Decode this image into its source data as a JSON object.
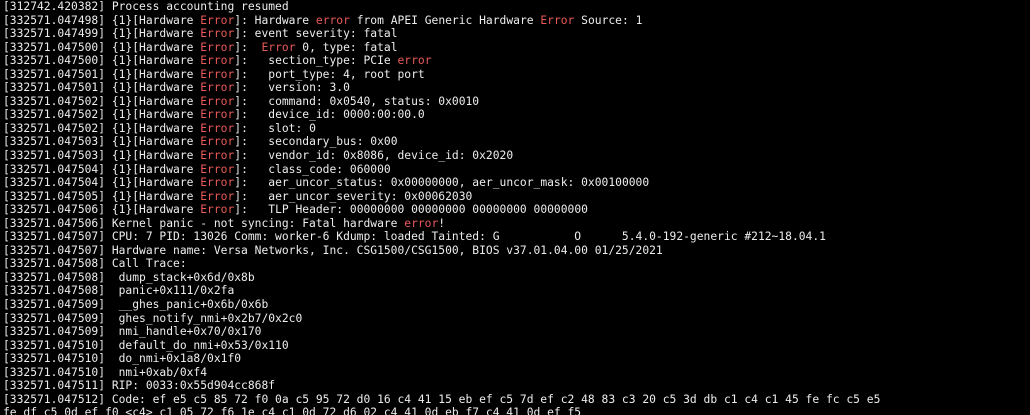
{
  "colors": {
    "background": "#000000",
    "text": "#ededed",
    "error": "#e85a5a"
  },
  "terminal": {
    "lines": [
      [
        {
          "t": "[312742.420382] Process accounting resumed"
        }
      ],
      [
        {
          "t": "[332571.047498] {1}[Hardware "
        },
        {
          "t": "Error",
          "c": "red"
        },
        {
          "t": "]: Hardware "
        },
        {
          "t": "error",
          "c": "red"
        },
        {
          "t": " from APEI Generic Hardware "
        },
        {
          "t": "Error",
          "c": "red"
        },
        {
          "t": " Source: 1"
        }
      ],
      [
        {
          "t": "[332571.047499] {1}[Hardware "
        },
        {
          "t": "Error",
          "c": "red"
        },
        {
          "t": "]: event severity: fatal"
        }
      ],
      [
        {
          "t": "[332571.047500] {1}[Hardware "
        },
        {
          "t": "Error",
          "c": "red"
        },
        {
          "t": "]:  "
        },
        {
          "t": "Error",
          "c": "red"
        },
        {
          "t": " 0, type: fatal"
        }
      ],
      [
        {
          "t": "[332571.047500] {1}[Hardware "
        },
        {
          "t": "Error",
          "c": "red"
        },
        {
          "t": "]:   section_type: PCIe "
        },
        {
          "t": "error",
          "c": "red"
        }
      ],
      [
        {
          "t": "[332571.047501] {1}[Hardware "
        },
        {
          "t": "Error",
          "c": "red"
        },
        {
          "t": "]:   port_type: 4, root port"
        }
      ],
      [
        {
          "t": "[332571.047501] {1}[Hardware "
        },
        {
          "t": "Error",
          "c": "red"
        },
        {
          "t": "]:   version: 3.0"
        }
      ],
      [
        {
          "t": "[332571.047502] {1}[Hardware "
        },
        {
          "t": "Error",
          "c": "red"
        },
        {
          "t": "]:   command: 0x0540, status: 0x0010"
        }
      ],
      [
        {
          "t": "[332571.047502] {1}[Hardware "
        },
        {
          "t": "Error",
          "c": "red"
        },
        {
          "t": "]:   device_id: 0000:00:00.0"
        }
      ],
      [
        {
          "t": "[332571.047502] {1}[Hardware "
        },
        {
          "t": "Error",
          "c": "red"
        },
        {
          "t": "]:   slot: 0"
        }
      ],
      [
        {
          "t": "[332571.047503] {1}[Hardware "
        },
        {
          "t": "Error",
          "c": "red"
        },
        {
          "t": "]:   secondary_bus: 0x00"
        }
      ],
      [
        {
          "t": "[332571.047503] {1}[Hardware "
        },
        {
          "t": "Error",
          "c": "red"
        },
        {
          "t": "]:   vendor_id: 0x8086, device_id: 0x2020"
        }
      ],
      [
        {
          "t": "[332571.047504] {1}[Hardware "
        },
        {
          "t": "Error",
          "c": "red"
        },
        {
          "t": "]:   class_code: 060000"
        }
      ],
      [
        {
          "t": "[332571.047504] {1}[Hardware "
        },
        {
          "t": "Error",
          "c": "red"
        },
        {
          "t": "]:   aer_uncor_status: 0x00000000, aer_uncor_mask: 0x00100000"
        }
      ],
      [
        {
          "t": "[332571.047505] {1}[Hardware "
        },
        {
          "t": "Error",
          "c": "red"
        },
        {
          "t": "]:   aer_uncor_severity: 0x00062030"
        }
      ],
      [
        {
          "t": "[332571.047506] {1}[Hardware "
        },
        {
          "t": "Error",
          "c": "red"
        },
        {
          "t": "]:   TLP Header: 00000000 00000000 00000000 00000000"
        }
      ],
      [
        {
          "t": "[332571.047506] Kernel panic - not syncing: Fatal hardware "
        },
        {
          "t": "error",
          "c": "red"
        },
        {
          "t": "!"
        }
      ],
      [
        {
          "t": "[332571.047507] CPU: 7 PID: 13026 Comm: worker-6 Kdump: loaded Tainted: G           O      5.4.0-192-generic #212~18.04.1"
        }
      ],
      [
        {
          "t": "[332571.047507] Hardware name: Versa Networks, Inc. CSG1500/CSG1500, BIOS v37.01.04.00 01/25/2021"
        }
      ],
      [
        {
          "t": "[332571.047508] Call Trace:"
        }
      ],
      [
        {
          "t": "[332571.047508]  dump_stack+0x6d/0x8b"
        }
      ],
      [
        {
          "t": "[332571.047508]  panic+0x111/0x2fa"
        }
      ],
      [
        {
          "t": "[332571.047509]  __ghes_panic+0x6b/0x6b"
        }
      ],
      [
        {
          "t": "[332571.047509]  ghes_notify_nmi+0x2b7/0x2c0"
        }
      ],
      [
        {
          "t": "[332571.047509]  nmi_handle+0x70/0x170"
        }
      ],
      [
        {
          "t": "[332571.047510]  default_do_nmi+0x53/0x110"
        }
      ],
      [
        {
          "t": "[332571.047510]  do_nmi+0x1a8/0x1f0"
        }
      ],
      [
        {
          "t": "[332571.047510]  nmi+0xab/0xf4"
        }
      ],
      [
        {
          "t": "[332571.047511] RIP: 0033:0x55d904cc868f"
        }
      ],
      [
        {
          "t": "[332571.047512] Code: ef e5 c5 85 72 f0 0a c5 95 72 d0 16 c4 41 15 eb ef c5 7d ef c2 48 83 c3 20 c5 3d db c1 c4 c1 45 fe fc c5 e5"
        }
      ],
      [
        {
          "t": "fe df c5 0d ef f0 <c4> c1 05 72 f6 1e c4 c1 0d 72 d6 02 c4 41 0d eb f7 c4 41 0d ef f5"
        }
      ]
    ]
  }
}
